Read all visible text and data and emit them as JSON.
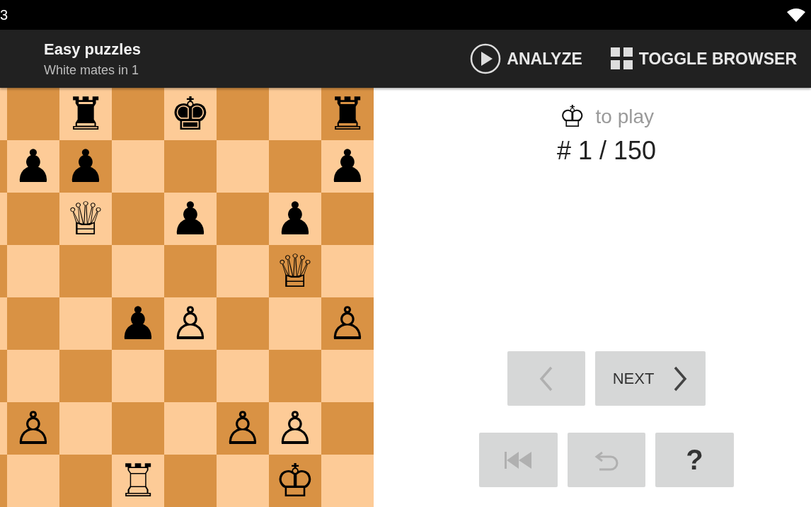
{
  "status_bar": {
    "time": "3"
  },
  "toolbar": {
    "title": "Easy puzzles",
    "subtitle": "White mates in 1",
    "actions": [
      {
        "kind": "analyze",
        "label": "ANALYZE"
      },
      {
        "kind": "browser",
        "label": "TOGGLE BROWSER"
      }
    ]
  },
  "board": {
    "rows": [
      [
        {},
        {},
        {
          "piece": "♜"
        },
        {},
        {
          "piece": "♚"
        },
        {},
        {},
        {
          "piece": "♜"
        }
      ],
      [
        {},
        {
          "piece": "♟"
        },
        {
          "piece": "♟"
        },
        {},
        {},
        {},
        {},
        {
          "piece": "♟"
        }
      ],
      [
        {},
        {},
        {
          "piece": "♕"
        },
        {},
        {
          "piece": "♟"
        },
        {},
        {
          "piece": "♟"
        },
        {}
      ],
      [
        {},
        {},
        {},
        {},
        {},
        {},
        {
          "piece": "♕"
        },
        {}
      ],
      [
        {},
        {},
        {},
        {
          "piece": "♟"
        },
        {
          "piece": "♙"
        },
        {},
        {},
        {
          "piece": "♙"
        }
      ],
      [
        {},
        {},
        {},
        {},
        {},
        {},
        {},
        {}
      ],
      [
        {},
        {
          "piece": "♙"
        },
        {},
        {},
        {},
        {
          "piece": "♙"
        },
        {
          "piece": "♙"
        },
        {}
      ],
      [
        {},
        {},
        {},
        {
          "piece": "♖"
        },
        {},
        {},
        {
          "piece": "♔"
        },
        {}
      ]
    ]
  },
  "puzzle": {
    "side_glyph": "♔",
    "to_play": "to play",
    "counter": "# 1 / 150"
  },
  "nav_buttons": [
    {
      "kind": "prev",
      "disabled": true
    },
    {
      "kind": "next",
      "label": "NEXT",
      "disabled": false
    }
  ],
  "tool_buttons": [
    {
      "kind": "first",
      "disabled": true
    },
    {
      "kind": "undo",
      "disabled": true
    },
    {
      "kind": "hint",
      "label": "?",
      "disabled": false
    }
  ]
}
